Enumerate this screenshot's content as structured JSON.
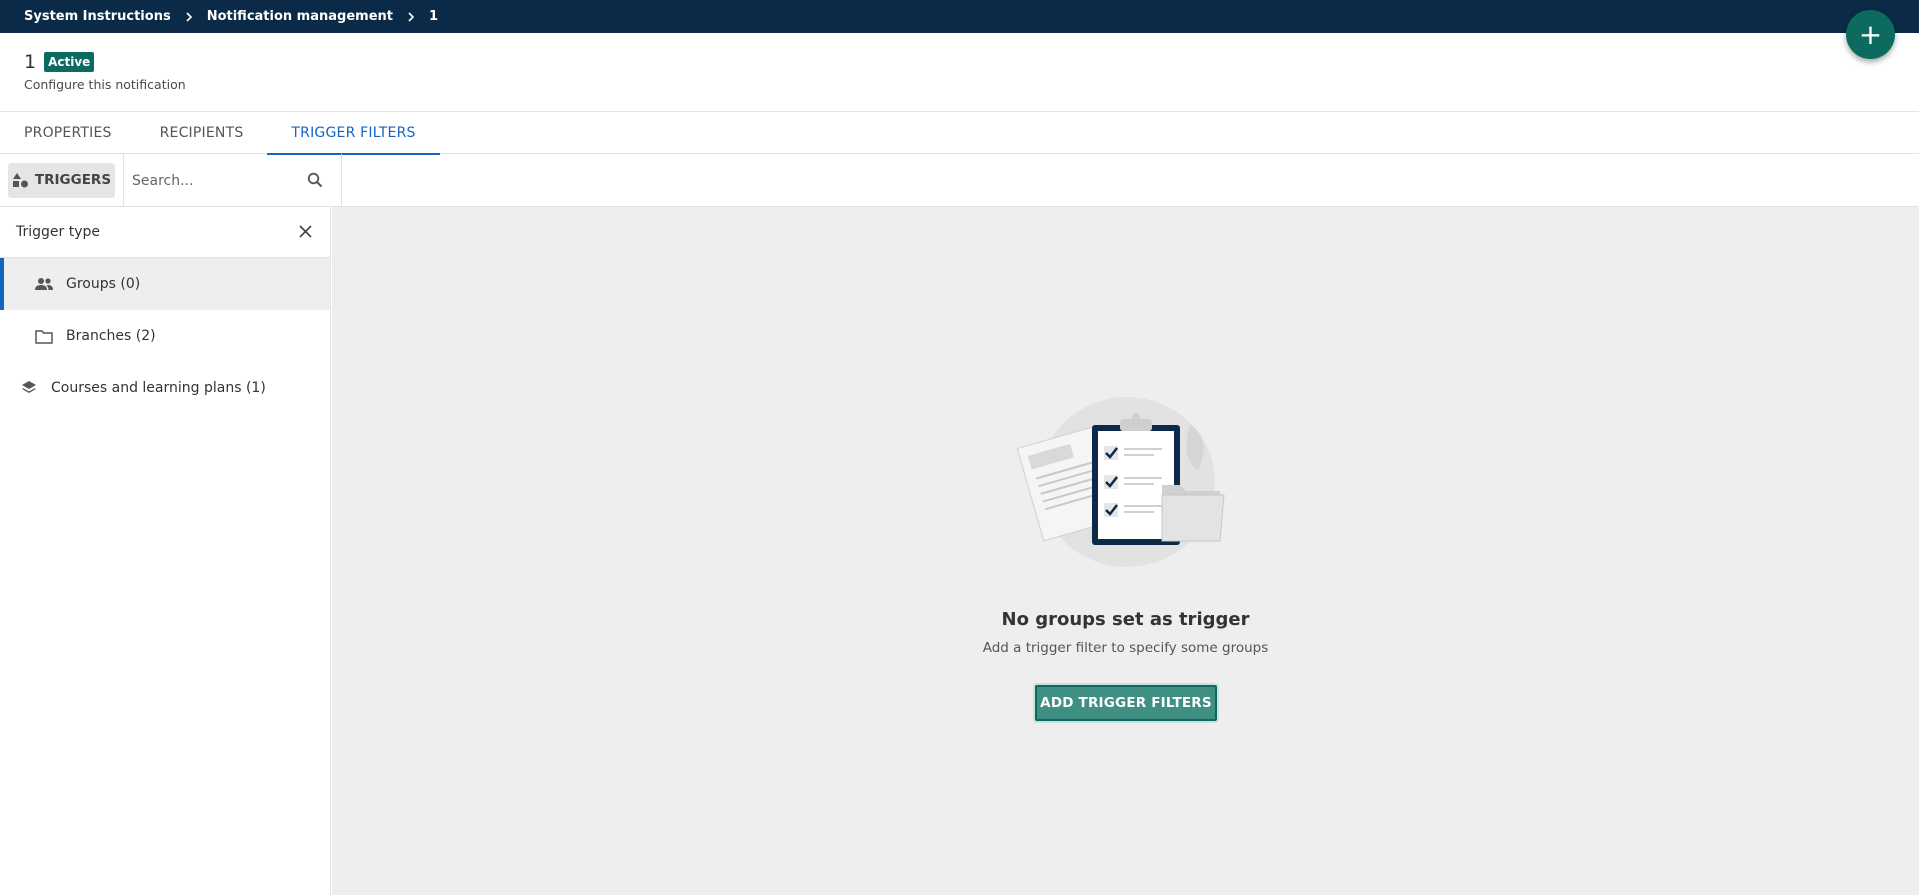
{
  "breadcrumb": {
    "items": [
      "System Instructions",
      "Notification management",
      "1"
    ]
  },
  "fab": {
    "label": "+",
    "icon": "plus-icon"
  },
  "header": {
    "title": "1",
    "status": "Active",
    "subtitle": "Configure this notification"
  },
  "tabs": [
    {
      "label": "PROPERTIES",
      "active": false
    },
    {
      "label": "RECIPIENTS",
      "active": false
    },
    {
      "label": "TRIGGER FILTERS",
      "active": true
    }
  ],
  "toolbar": {
    "triggers_label": "TRIGGERS",
    "search_placeholder": "Search..."
  },
  "sidebar": {
    "heading": "Trigger type",
    "items": [
      {
        "label": "Groups (0)",
        "icon": "people-icon",
        "active": true
      },
      {
        "label": "Branches (2)",
        "icon": "folder-icon",
        "active": false
      },
      {
        "label": "Courses and learning plans (1)",
        "icon": "layers-icon",
        "active": false
      }
    ]
  },
  "empty_state": {
    "title": "No groups set as trigger",
    "subtitle": "Add a trigger filter to specify some groups",
    "button_label": "ADD TRIGGER FILTERS"
  },
  "colors": {
    "topbar": "#0b2a47",
    "accent": "#0c6b5e",
    "tab_active": "#1565c0"
  }
}
